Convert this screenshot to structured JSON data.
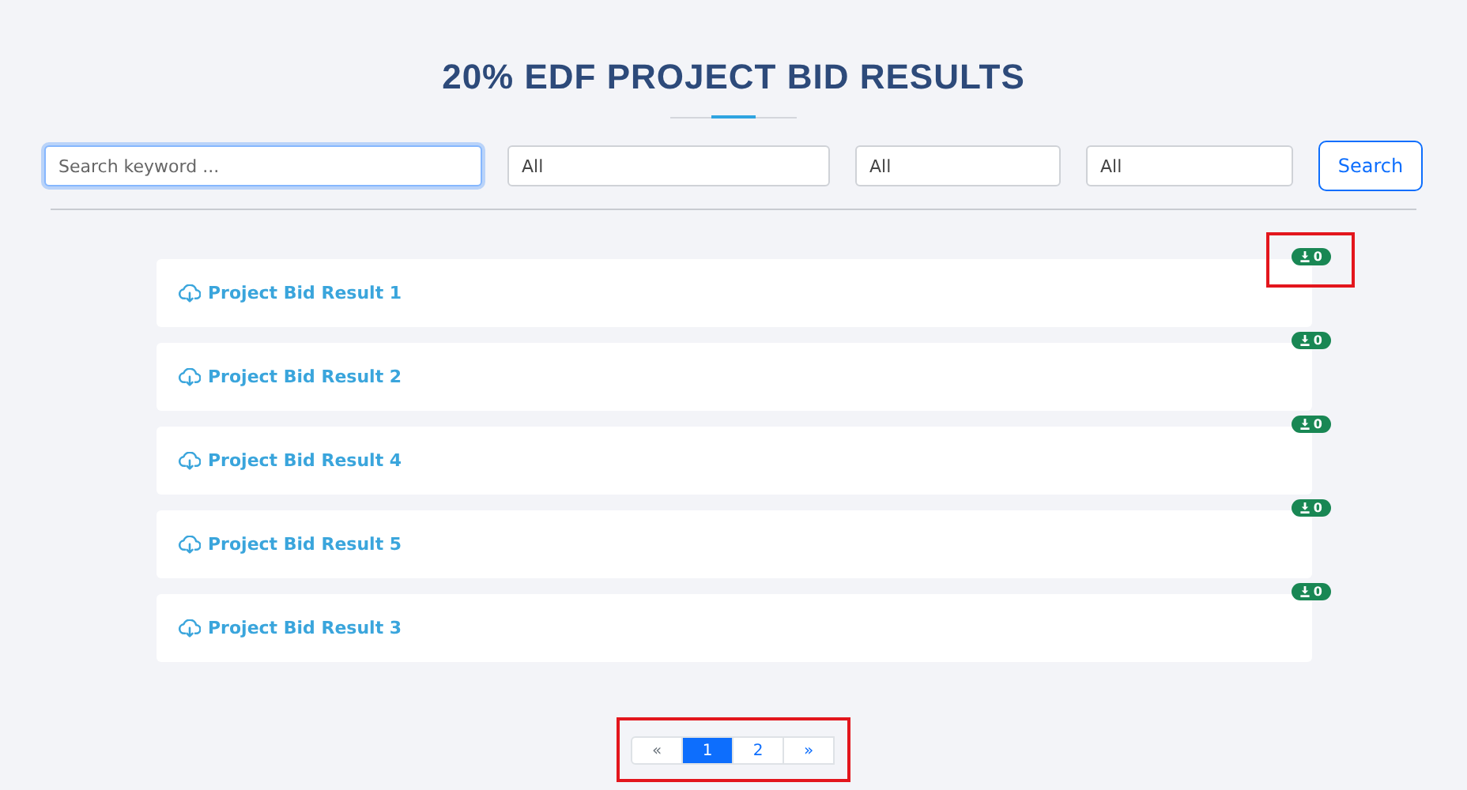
{
  "title": "20% EDF PROJECT BID RESULTS",
  "filters": {
    "search": {
      "placeholder": "Search keyword ...",
      "focused": true
    },
    "selects": [
      {
        "value": "All"
      },
      {
        "value": "All"
      },
      {
        "value": "All"
      }
    ],
    "button": "Search"
  },
  "results": [
    {
      "label": "Project Bid Result 1",
      "downloads": "0",
      "highlighted": true
    },
    {
      "label": "Project Bid Result 2",
      "downloads": "0",
      "highlighted": false
    },
    {
      "label": "Project Bid Result 4",
      "downloads": "0",
      "highlighted": false
    },
    {
      "label": "Project Bid Result 5",
      "downloads": "0",
      "highlighted": false
    },
    {
      "label": "Project Bid Result 3",
      "downloads": "0",
      "highlighted": false
    }
  ],
  "pagination": {
    "highlighted": true,
    "pages": [
      {
        "label": "«",
        "selected": false
      },
      {
        "label": "1",
        "selected": true
      },
      {
        "label": "2",
        "selected": false
      },
      {
        "label": "»",
        "selected": false
      }
    ]
  }
}
